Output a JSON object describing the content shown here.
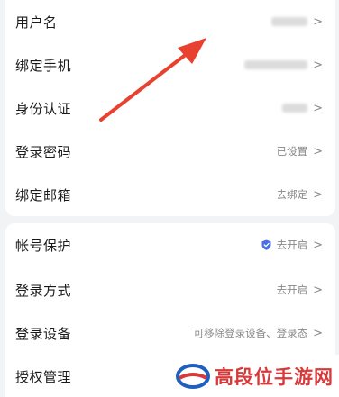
{
  "account": {
    "items": [
      {
        "label": "用户名",
        "value": "",
        "masked": true
      },
      {
        "label": "绑定手机",
        "value": "",
        "masked": true
      },
      {
        "label": "身份认证",
        "value": "",
        "masked": true
      },
      {
        "label": "登录密码",
        "value": "已设置"
      },
      {
        "label": "绑定邮箱",
        "value": "去绑定"
      }
    ]
  },
  "security": {
    "items": [
      {
        "label": "帐号保护",
        "value": "去开启",
        "icon": "shield-icon"
      },
      {
        "label": "登录方式",
        "value": "去开启"
      },
      {
        "label": "登录设备",
        "value": "可移除登录设备、登录态"
      },
      {
        "label": "授权管理",
        "value": ""
      }
    ]
  },
  "chevron": ">",
  "watermark": {
    "text": "高段位手游网"
  },
  "colors": {
    "arrow": "#e8412f",
    "shield": "#4a6fe0",
    "watermark": "#d63a3a",
    "watermark_ring": "#1f5fbf"
  }
}
